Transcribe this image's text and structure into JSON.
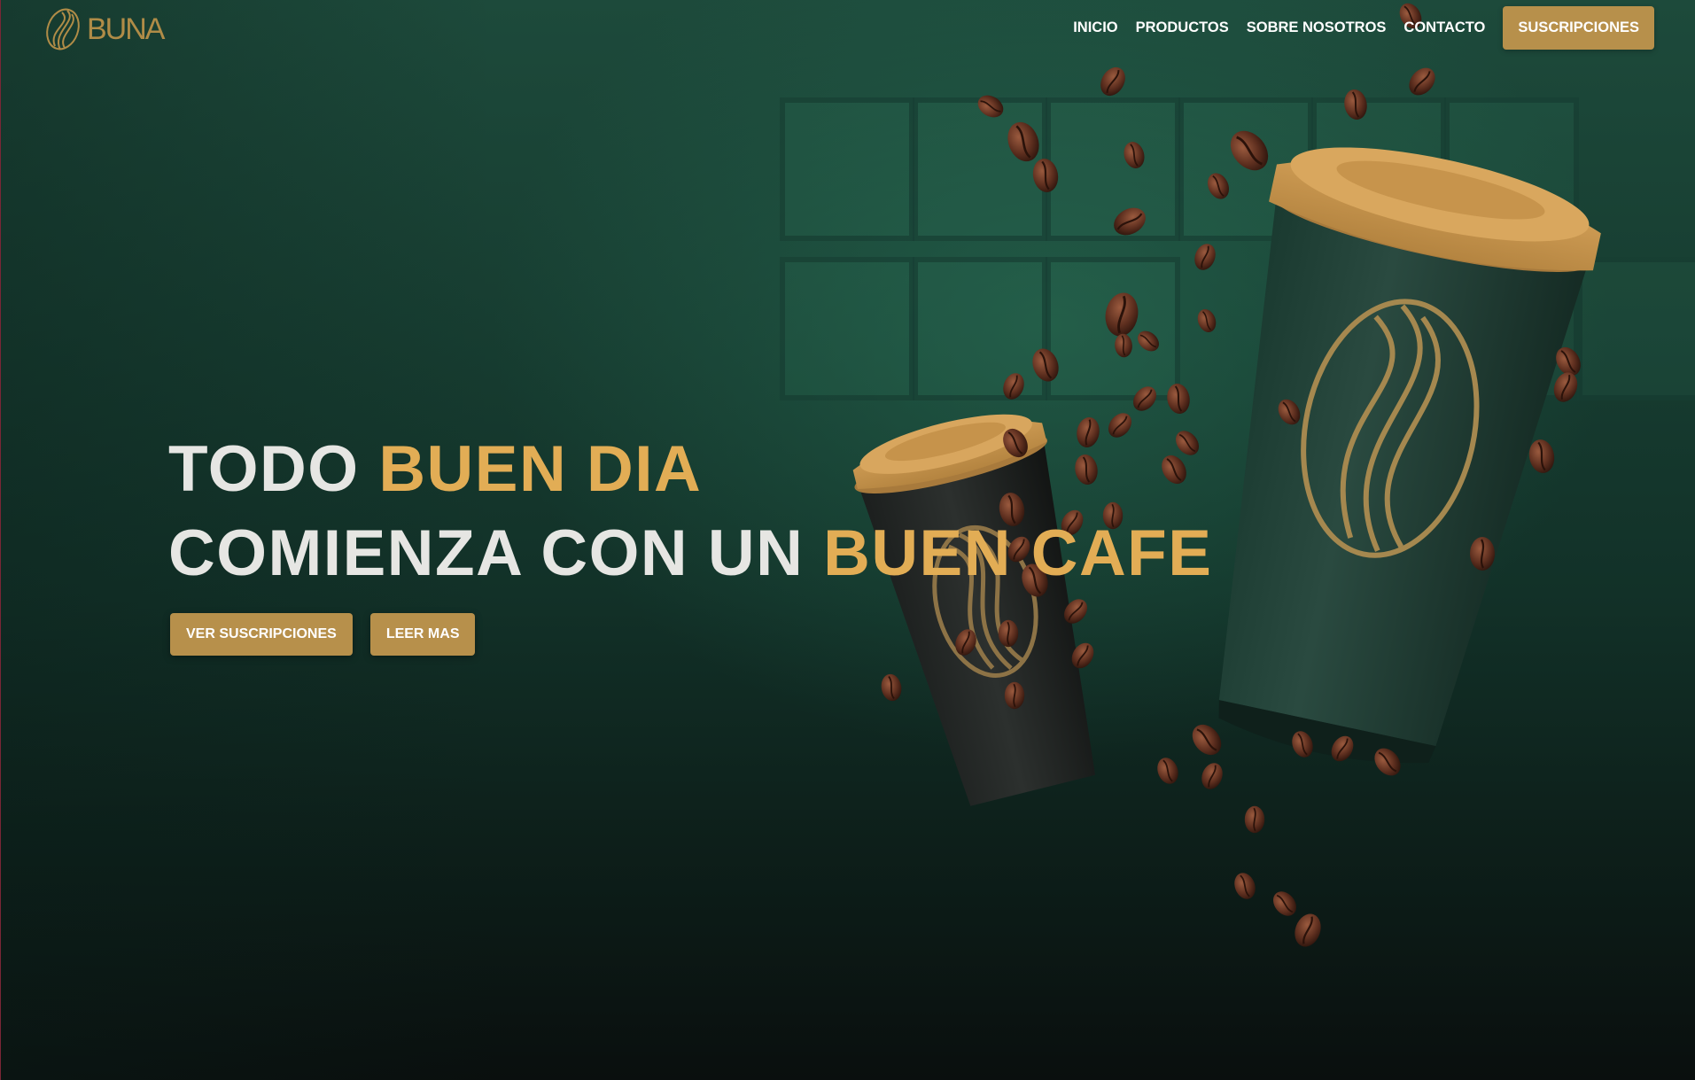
{
  "brand": {
    "logo_text": "BUNA",
    "logo_icon": "coffee-bean-leaf-icon"
  },
  "nav": {
    "links": [
      "INICIO",
      "PRODUCTOS",
      "SOBRE NOSOTROS",
      "CONTACTO"
    ],
    "cta_label": "SUSCRIPCIONES"
  },
  "hero": {
    "line1_white": "TODO ",
    "line1_gold": "BUEN DIA",
    "line2_white": "COMIENZA CON UN ",
    "line2_gold": "BUEN CAFE",
    "primary_button": "VER SUSCRIPCIONES",
    "secondary_button": "LEER MAS"
  },
  "colors": {
    "accent_gold": "#b7904b",
    "headline_gold": "#e2ad55",
    "headline_white": "#e6e6e3",
    "bg_green": "#173d31"
  },
  "illustration": {
    "subject": "two-coffee-cups-with-flying-beans",
    "cup_icon": "coffee-cup-icon",
    "bean_icon": "coffee-bean-icon"
  }
}
